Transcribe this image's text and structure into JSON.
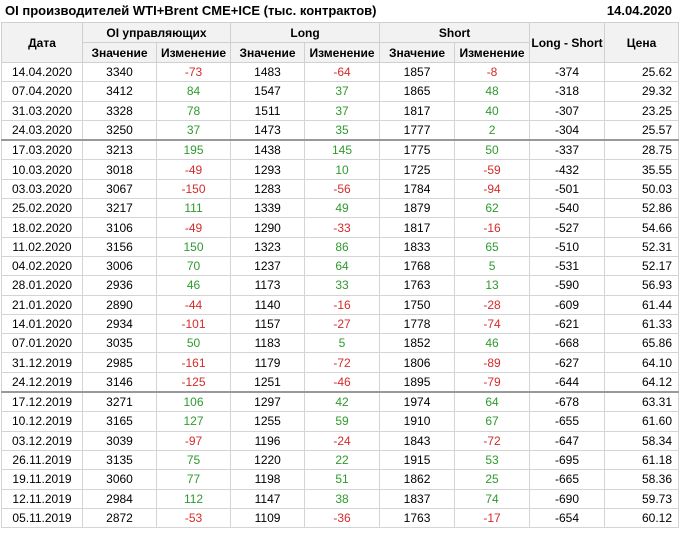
{
  "header": {
    "title": "OI производителей WTI+Brent CME+ICE (тыс. контрактов)",
    "date": "14.04.2020"
  },
  "columns": {
    "date": "Дата",
    "oi": "OI управляющих",
    "long": "Long",
    "short": "Short",
    "long_short": "Long - Short",
    "price": "Цена",
    "value": "Значение",
    "change": "Изменение"
  },
  "colors": {
    "positive": "#2e9a2e",
    "negative": "#d42b2b"
  },
  "rows": [
    {
      "date": "14.04.2020",
      "oi": "3340",
      "oi_chg": "-73",
      "long": "1483",
      "long_chg": "-64",
      "short": "1857",
      "short_chg": "-8",
      "ls": "-374",
      "price": "25.62"
    },
    {
      "date": "07.04.2020",
      "oi": "3412",
      "oi_chg": "84",
      "long": "1547",
      "long_chg": "37",
      "short": "1865",
      "short_chg": "48",
      "ls": "-318",
      "price": "29.32"
    },
    {
      "date": "31.03.2020",
      "oi": "3328",
      "oi_chg": "78",
      "long": "1511",
      "long_chg": "37",
      "short": "1817",
      "short_chg": "40",
      "ls": "-307",
      "price": "23.25"
    },
    {
      "date": "24.03.2020",
      "oi": "3250",
      "oi_chg": "37",
      "long": "1473",
      "long_chg": "35",
      "short": "1777",
      "short_chg": "2",
      "ls": "-304",
      "price": "25.57"
    },
    {
      "date": "17.03.2020",
      "oi": "3213",
      "oi_chg": "195",
      "long": "1438",
      "long_chg": "145",
      "short": "1775",
      "short_chg": "50",
      "ls": "-337",
      "price": "28.75"
    },
    {
      "date": "10.03.2020",
      "oi": "3018",
      "oi_chg": "-49",
      "long": "1293",
      "long_chg": "10",
      "short": "1725",
      "short_chg": "-59",
      "ls": "-432",
      "price": "35.55"
    },
    {
      "date": "03.03.2020",
      "oi": "3067",
      "oi_chg": "-150",
      "long": "1283",
      "long_chg": "-56",
      "short": "1784",
      "short_chg": "-94",
      "ls": "-501",
      "price": "50.03"
    },
    {
      "date": "25.02.2020",
      "oi": "3217",
      "oi_chg": "111",
      "long": "1339",
      "long_chg": "49",
      "short": "1879",
      "short_chg": "62",
      "ls": "-540",
      "price": "52.86"
    },
    {
      "date": "18.02.2020",
      "oi": "3106",
      "oi_chg": "-49",
      "long": "1290",
      "long_chg": "-33",
      "short": "1817",
      "short_chg": "-16",
      "ls": "-527",
      "price": "54.66"
    },
    {
      "date": "11.02.2020",
      "oi": "3156",
      "oi_chg": "150",
      "long": "1323",
      "long_chg": "86",
      "short": "1833",
      "short_chg": "65",
      "ls": "-510",
      "price": "52.31"
    },
    {
      "date": "04.02.2020",
      "oi": "3006",
      "oi_chg": "70",
      "long": "1237",
      "long_chg": "64",
      "short": "1768",
      "short_chg": "5",
      "ls": "-531",
      "price": "52.17"
    },
    {
      "date": "28.01.2020",
      "oi": "2936",
      "oi_chg": "46",
      "long": "1173",
      "long_chg": "33",
      "short": "1763",
      "short_chg": "13",
      "ls": "-590",
      "price": "56.93"
    },
    {
      "date": "21.01.2020",
      "oi": "2890",
      "oi_chg": "-44",
      "long": "1140",
      "long_chg": "-16",
      "short": "1750",
      "short_chg": "-28",
      "ls": "-609",
      "price": "61.44"
    },
    {
      "date": "14.01.2020",
      "oi": "2934",
      "oi_chg": "-101",
      "long": "1157",
      "long_chg": "-27",
      "short": "1778",
      "short_chg": "-74",
      "ls": "-621",
      "price": "61.33"
    },
    {
      "date": "07.01.2020",
      "oi": "3035",
      "oi_chg": "50",
      "long": "1183",
      "long_chg": "5",
      "short": "1852",
      "short_chg": "46",
      "ls": "-668",
      "price": "65.86"
    },
    {
      "date": "31.12.2019",
      "oi": "2985",
      "oi_chg": "-161",
      "long": "1179",
      "long_chg": "-72",
      "short": "1806",
      "short_chg": "-89",
      "ls": "-627",
      "price": "64.10"
    },
    {
      "date": "24.12.2019",
      "oi": "3146",
      "oi_chg": "-125",
      "long": "1251",
      "long_chg": "-46",
      "short": "1895",
      "short_chg": "-79",
      "ls": "-644",
      "price": "64.12"
    },
    {
      "date": "17.12.2019",
      "oi": "3271",
      "oi_chg": "106",
      "long": "1297",
      "long_chg": "42",
      "short": "1974",
      "short_chg": "64",
      "ls": "-678",
      "price": "63.31"
    },
    {
      "date": "10.12.2019",
      "oi": "3165",
      "oi_chg": "127",
      "long": "1255",
      "long_chg": "59",
      "short": "1910",
      "short_chg": "67",
      "ls": "-655",
      "price": "61.60"
    },
    {
      "date": "03.12.2019",
      "oi": "3039",
      "oi_chg": "-97",
      "long": "1196",
      "long_chg": "-24",
      "short": "1843",
      "short_chg": "-72",
      "ls": "-647",
      "price": "58.34"
    },
    {
      "date": "26.11.2019",
      "oi": "3135",
      "oi_chg": "75",
      "long": "1220",
      "long_chg": "22",
      "short": "1915",
      "short_chg": "53",
      "ls": "-695",
      "price": "61.18"
    },
    {
      "date": "19.11.2019",
      "oi": "3060",
      "oi_chg": "77",
      "long": "1198",
      "long_chg": "51",
      "short": "1862",
      "short_chg": "25",
      "ls": "-665",
      "price": "58.36"
    },
    {
      "date": "12.11.2019",
      "oi": "2984",
      "oi_chg": "112",
      "long": "1147",
      "long_chg": "38",
      "short": "1837",
      "short_chg": "74",
      "ls": "-690",
      "price": "59.73"
    },
    {
      "date": "05.11.2019",
      "oi": "2872",
      "oi_chg": "-53",
      "long": "1109",
      "long_chg": "-36",
      "short": "1763",
      "short_chg": "-17",
      "ls": "-654",
      "price": "60.12"
    }
  ]
}
